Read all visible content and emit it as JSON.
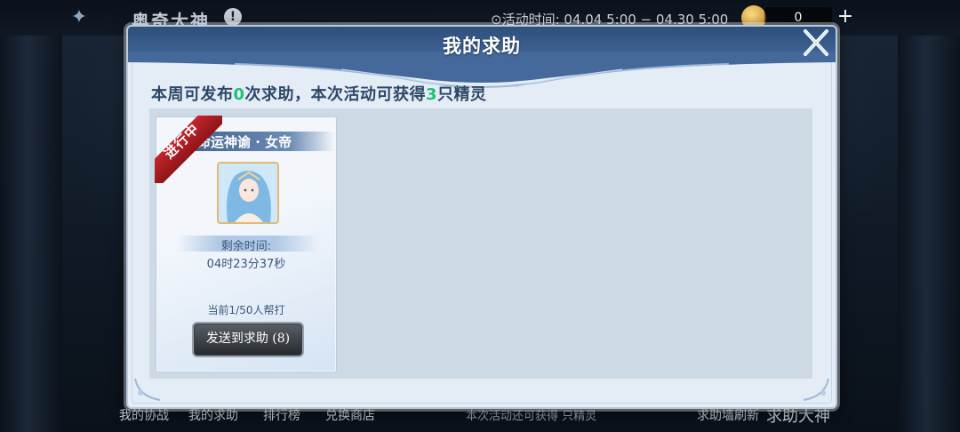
{
  "topbar": {
    "title": "奥奇大神",
    "time_label": "⊙活动时间: 04.04 5:00 − 04.30 5:00",
    "coin_count": "0"
  },
  "bottom_nav": {
    "items": [
      "我的协战",
      "我的求助",
      "排行榜",
      "兑换商店"
    ],
    "center_hint": "本次活动还可获得 只精灵",
    "refresh": "求助墙刷新",
    "right_title": "求助大神"
  },
  "dialog": {
    "title": "我的求助",
    "info": {
      "prefix": "本周可发布",
      "publish_count": "0",
      "middle": "次求助，本次活动可获得",
      "reward_count": "3",
      "suffix": "只精灵"
    },
    "card": {
      "status_ribbon": "进行中",
      "title": "命运神谕 · 女帝",
      "remaining_label": "剩余时间:",
      "remaining_time": "04时23分37秒",
      "helpers": "当前1/50人帮打",
      "send_button": "发送到求助 (8)"
    }
  },
  "colors": {
    "highlight_number": "#21c07a",
    "header_blue": "#2d4f7c",
    "ribbon_red": "#c2272d"
  },
  "icons": [
    "close-icon",
    "warning-icon",
    "coin-icon",
    "plus-icon",
    "game-logo-icon"
  ]
}
